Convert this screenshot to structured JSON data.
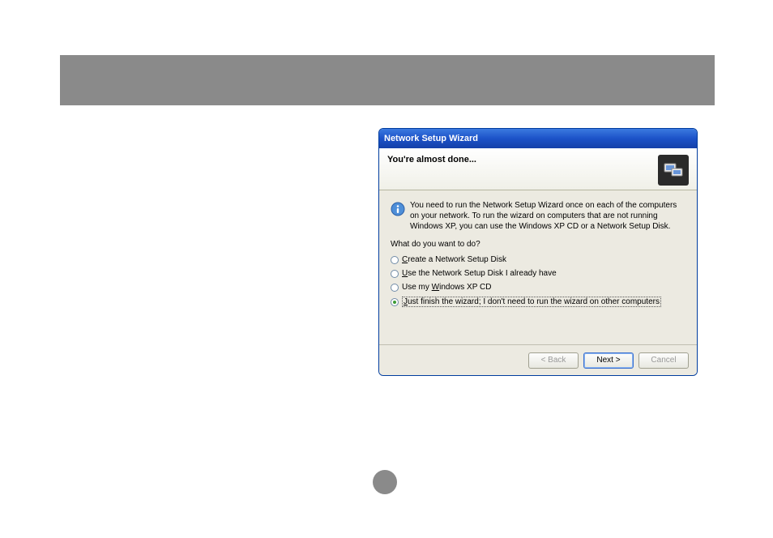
{
  "dialog": {
    "title": "Network Setup Wizard",
    "header": "You're almost done...",
    "info_text": "You need to run the Network Setup Wizard once on each of the computers on your network. To run the wizard on computers that are not running Windows XP, you can use the Windows XP CD or a Network Setup Disk.",
    "question": "What do you want to do?",
    "options": [
      {
        "accel": "C",
        "rest": "reate a Network Setup Disk",
        "checked": false
      },
      {
        "accel": "U",
        "rest": "se the Network Setup Disk I already have",
        "checked": false
      },
      {
        "accel": "",
        "pre": "Use my ",
        "accel2": "W",
        "rest": "indows XP CD",
        "checked": false
      },
      {
        "accel": "J",
        "rest": "ust finish the wizard; I don't need to run the wizard on other computers",
        "checked": true
      }
    ],
    "buttons": {
      "back": "< Back",
      "next_pre": "",
      "next_accel": "N",
      "next_rest": "ext >",
      "cancel": "Cancel"
    }
  }
}
